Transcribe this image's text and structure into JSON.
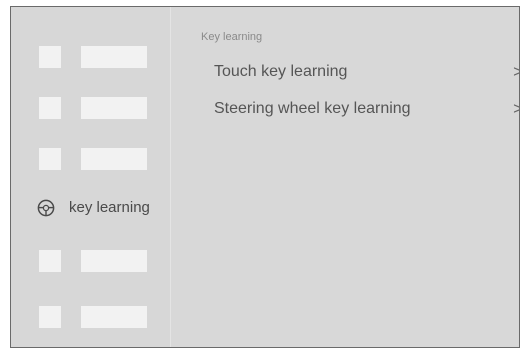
{
  "sidebar": {
    "active_item": {
      "label": "key learning",
      "icon": "steering-wheel-icon"
    }
  },
  "main": {
    "section_title": "Key learning",
    "items": [
      {
        "label": "Touch key learning",
        "chevron": ">"
      },
      {
        "label": "Steering wheel key learning",
        "chevron": ">"
      }
    ]
  },
  "colors": {
    "panel_bg": "#d8d8d8",
    "placeholder": "#f2f2f2",
    "text": "#555555",
    "muted_text": "#8a8a8a",
    "frame_border": "#6a6a6a"
  }
}
